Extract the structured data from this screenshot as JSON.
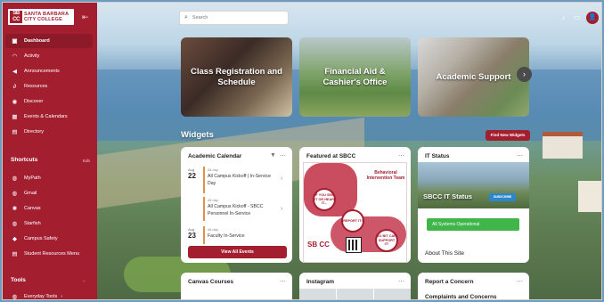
{
  "brand": {
    "logo_mark": "SB CC",
    "logo_text_1": "SANTA BARBARA",
    "logo_text_2": "CITY COLLEGE"
  },
  "sidebar": {
    "items": [
      {
        "label": "Dashboard",
        "icon": "dashboard-icon"
      },
      {
        "label": "Activity",
        "icon": "rss-icon"
      },
      {
        "label": "Announcements",
        "icon": "megaphone-icon"
      },
      {
        "label": "Resources",
        "icon": "paperclip-icon"
      },
      {
        "label": "Discover",
        "icon": "compass-icon"
      },
      {
        "label": "Events & Calendars",
        "icon": "calendar-icon"
      },
      {
        "label": "Directory",
        "icon": "directory-icon"
      }
    ],
    "shortcuts_title": "Shortcuts",
    "shortcuts_edit": "Edit",
    "shortcuts": [
      {
        "label": "MyPath"
      },
      {
        "label": "Gmail"
      },
      {
        "label": "Canvas"
      },
      {
        "label": "Starfish"
      },
      {
        "label": "Campus Safety"
      },
      {
        "label": "Student Resources Menu"
      }
    ],
    "tools_title": "Tools",
    "tools_item": "Everyday Tools"
  },
  "search": {
    "placeholder": "Search"
  },
  "user": {
    "initial": "👤"
  },
  "quicklinks": [
    {
      "label": "Class Registration and Schedule"
    },
    {
      "label": "Financial Aid & Cashier's Office"
    },
    {
      "label": "Academic Support"
    }
  ],
  "widgets": {
    "title": "Widgets",
    "find_button": "Find New Widgets",
    "calendar": {
      "title": "Academic Calendar",
      "events": [
        {
          "month": "Aug",
          "day": "22",
          "time": "All day",
          "title": "All Campus Kickoff | In-Service Day"
        },
        {
          "month": "",
          "day": "",
          "time": "All day",
          "title": "All Campus Kickoff - SBCC Personnel In-Service"
        },
        {
          "month": "Aug",
          "day": "23",
          "time": "All day",
          "title": "Faculty In-Service"
        }
      ],
      "view_all": "View All Events"
    },
    "featured": {
      "title": "Featured at SBCC",
      "poster_title": "Behavioral Intervention Team",
      "bubble_1": "IF YOU SEE IT OR HEAR IT...",
      "bubble_2": "REPORT IT!",
      "bubble_3": "SO BIT CAN SUPPORT IT!",
      "poster_logo": "SB CC"
    },
    "it_status": {
      "title": "IT Status",
      "image_label": "SBCC IT Status",
      "subscribe": "SUBSCRIBE",
      "status": "All Systems Operational",
      "about": "About This Site"
    },
    "canvas": {
      "title": "Canvas Courses"
    },
    "instagram": {
      "title": "Instagram"
    },
    "report": {
      "title": "Report a Concern",
      "subtitle": "Complaints and Concerns"
    }
  }
}
